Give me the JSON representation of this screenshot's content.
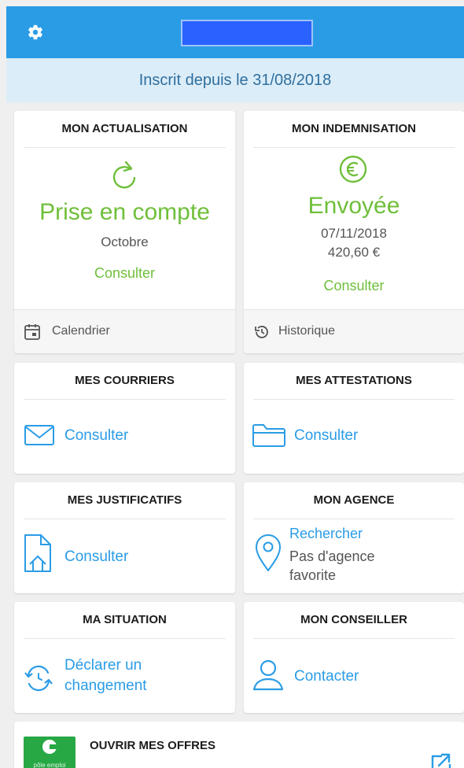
{
  "header": {
    "settings_icon": "gear-icon",
    "accent": "#2a9ce6"
  },
  "banner": {
    "text": "Inscrit depuis le 31/08/2018"
  },
  "actualisation": {
    "title": "MON ACTUALISATION",
    "icon": "refresh-icon",
    "status": "Prise en compte",
    "month": "Octobre",
    "link": "Consulter",
    "footer_icon": "calendar-icon",
    "footer_label": "Calendrier"
  },
  "indemnisation": {
    "title": "MON INDEMNISATION",
    "icon": "euro-icon",
    "status": "Envoyée",
    "date": "07/11/2018",
    "amount": "420,60 €",
    "link": "Consulter",
    "footer_icon": "history-icon",
    "footer_label": "Historique"
  },
  "courriers": {
    "title": "MES COURRIERS",
    "icon": "envelope-icon",
    "link": "Consulter"
  },
  "attestations": {
    "title": "MES ATTESTATIONS",
    "icon": "folder-icon",
    "link": "Consulter"
  },
  "justificatifs": {
    "title": "MES JUSTIFICATIFS",
    "icon": "document-upload-icon",
    "link": "Consulter"
  },
  "agence": {
    "title": "MON AGENCE",
    "icon": "location-pin-icon",
    "link": "Rechercher",
    "note_line1": "Pas d'agence",
    "note_line2": "favorite"
  },
  "situation": {
    "title": "MA SITUATION",
    "icon": "sync-icon",
    "link_line1": "Déclarer un",
    "link_line2": "changement"
  },
  "conseiller": {
    "title": "MON CONSEILLER",
    "icon": "user-icon",
    "link": "Contacter"
  },
  "offres": {
    "title": "OUVRIR MES OFFRES",
    "logo_text": "pôle emploi",
    "icon": "external-link-icon"
  },
  "colors": {
    "green": "#6fbf3a",
    "blue": "#2a9ce6",
    "banner_bg": "#dbedf8"
  }
}
